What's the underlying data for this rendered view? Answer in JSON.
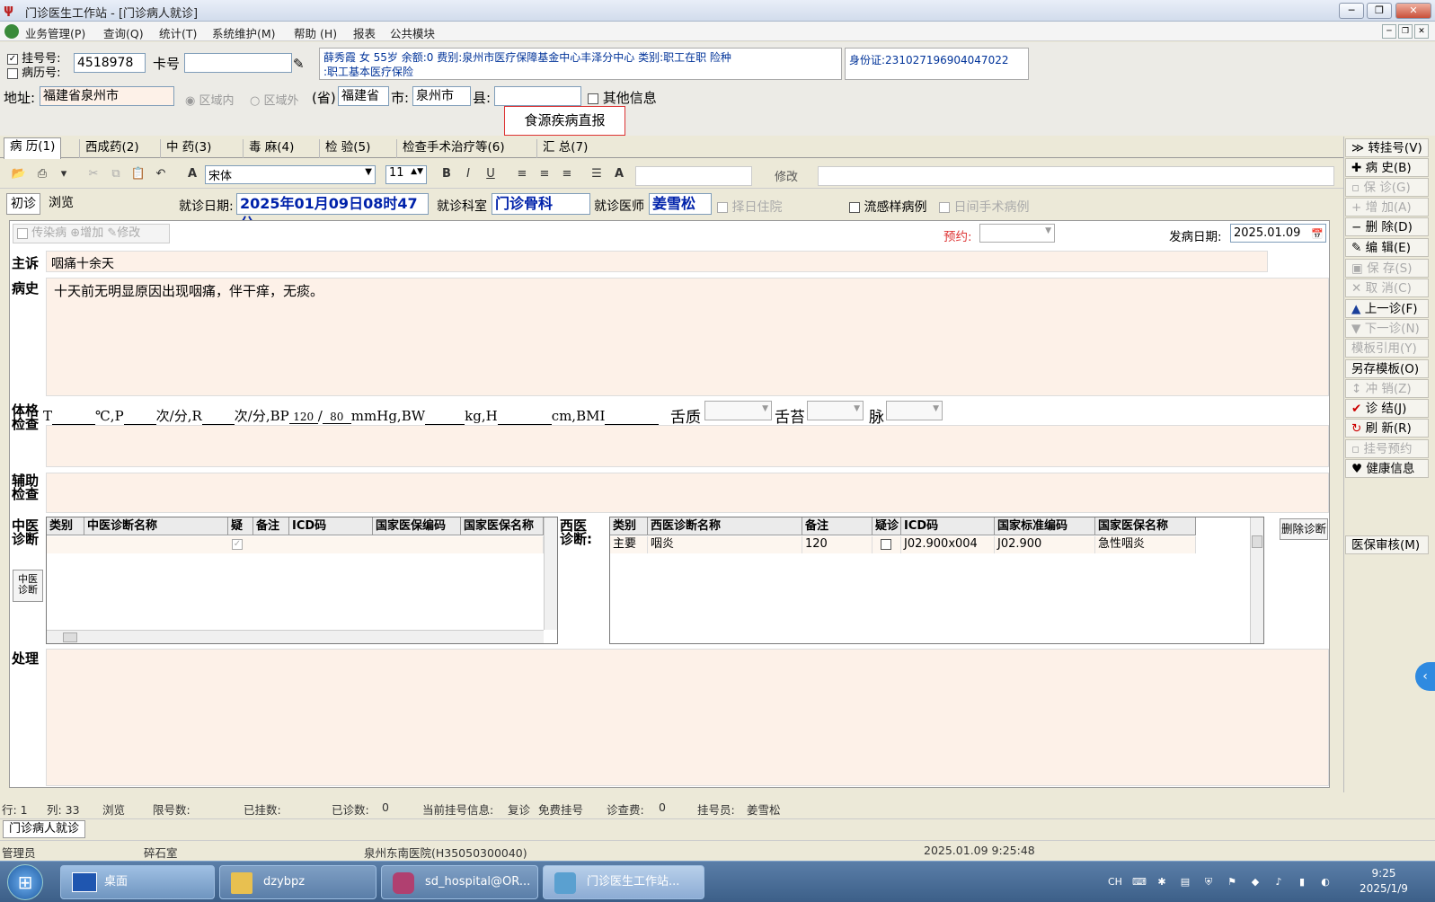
{
  "window": {
    "title": "门诊医生工作站 - [门诊病人就诊]",
    "minimize": "─",
    "restore": "❐",
    "close": "✕",
    "mdi_min": "─",
    "mdi_restore": "❐",
    "mdi_close": "✕"
  },
  "menu": [
    "业务管理(P)",
    "查询(Q)",
    "统计(T)",
    "系统维护(M)",
    "帮助 (H)",
    "报表",
    "公共模块"
  ],
  "info": {
    "reg_label": "挂号号:",
    "record_label": "病历号:",
    "reg_no": "4518978",
    "card_label": "卡号",
    "card_value": "",
    "patient_line1": "薛秀霞 女 55岁 余额:0 费别:泉州市医疗保障基金中心丰泽分中心 类别:职工在职 险种",
    "patient_line2": ":职工基本医疗保险",
    "id_card": "身份证:231027196904047022",
    "address_label": "地址:",
    "address": "福建省泉州市",
    "in_region": "区域内",
    "out_region": "区域外",
    "province_label": "(省)",
    "province": "福建省",
    "city_label": "市:",
    "city": "泉州市",
    "county_label": "县:",
    "county": "",
    "other_info": "其他信息",
    "notify_button": "食源疾病直报"
  },
  "tabs": [
    "病 历(1)",
    "西成药(2)",
    "中 药(3)",
    "毒 麻(4)",
    "检 验(5)",
    "检查手术治疗等(6)",
    "汇 总(7)"
  ],
  "toolbar": {
    "font": "宋体",
    "size": "11",
    "modify": "修改"
  },
  "visit": {
    "first_visit": "初诊",
    "browse": "浏览",
    "date_label": "就诊日期:",
    "date": "2025年01月09日08时47分",
    "dept_label": "就诊科室",
    "dept": "门诊骨科",
    "doctor_label": "就诊医师",
    "doctor": "姜雪松",
    "hospitalize": "择日住院",
    "flu": "流感样病例",
    "day_surgery": "日间手术病例",
    "infectious": "传染病",
    "add": "增加",
    "edit": "修改",
    "reserve_label": "预约:",
    "onset_label": "发病日期:",
    "onset_date": "2025.01.09"
  },
  "record": {
    "complaint_label": "主诉",
    "complaint": "咽痛十余天",
    "history_label": "病史",
    "history": "十天前无明显原因出现咽痛，伴干痒，无痰。",
    "exam_label": "体格检查",
    "vitals": {
      "t_label": "T",
      "t_unit": "℃,P",
      "p_unit": "次/分,R",
      "r_unit": "次/分,BP",
      "bp_sys": "120",
      "bp_sep": "/",
      "bp_dia": "80",
      "bp_unit": "mmHg,BW",
      "bw_unit": "kg,H",
      "h_unit": "cm,BMI",
      "tongue": "舌质",
      "coating": "舌苔",
      "pulse": "脉"
    },
    "aux_label": "辅助检查",
    "tcm_label": "中医诊断",
    "tcm_btn": "中医诊断",
    "wm_label": "西医诊断:",
    "treatment_label": "处理"
  },
  "tcm_grid": {
    "headers": [
      "类别",
      "中医诊断名称",
      "疑诊",
      "备注",
      "ICD码",
      "国家医保编码",
      "国家医保名称"
    ]
  },
  "wm_grid": {
    "headers": [
      "类别",
      "西医诊断名称",
      "备注",
      "疑诊",
      "ICD码",
      "国家标准编码",
      "国家医保名称"
    ],
    "rows": [
      [
        "主要",
        "咽炎",
        "120",
        "",
        "J02.900x004",
        "J02.900",
        "急性咽炎"
      ]
    ]
  },
  "delete_diag": "删除诊断",
  "side_buttons": [
    {
      "label": "转挂号(V)",
      "icon": "≫",
      "dim": false
    },
    {
      "label": "病 史(B)",
      "icon": "✚",
      "dim": false
    },
    {
      "label": "保 诊(G)",
      "icon": "▫",
      "dim": true
    },
    {
      "label": "增 加(A)",
      "icon": "+",
      "dim": true
    },
    {
      "label": "删 除(D)",
      "icon": "−",
      "dim": false
    },
    {
      "label": "编 辑(E)",
      "icon": "✎",
      "dim": false
    },
    {
      "label": "保 存(S)",
      "icon": "▣",
      "dim": true
    },
    {
      "label": "取 消(C)",
      "icon": "✕",
      "dim": true
    },
    {
      "label": "上一诊(F)",
      "icon": "▲",
      "dim": false
    },
    {
      "label": "下一诊(N)",
      "icon": "▼",
      "dim": true
    },
    {
      "label": "模板引用(Y)",
      "icon": "",
      "dim": true
    },
    {
      "label": "另存模板(O)",
      "icon": "",
      "dim": false
    },
    {
      "label": "冲 销(Z)",
      "icon": "↕",
      "dim": true
    },
    {
      "label": "诊 结(J)",
      "icon": "✔",
      "dim": false
    },
    {
      "label": "刷 新(R)",
      "icon": "↻",
      "dim": false
    },
    {
      "label": "挂号预约",
      "icon": "▫",
      "dim": true
    },
    {
      "label": "健康信息",
      "icon": "♥",
      "dim": false
    }
  ],
  "insurance_review": "医保审核(M)",
  "status": {
    "row": "行: 1",
    "col": "列: 33",
    "browse": "浏览",
    "limit": "限号数:",
    "registered": "已挂数:",
    "seen": "已诊数:",
    "seen_val": "0",
    "current": "当前挂号信息:",
    "revisit": "复诊",
    "free": "免费挂号",
    "fee": "诊查费:",
    "fee_val": "0",
    "registrar": "挂号员:",
    "registrar_val": "姜雪松"
  },
  "doc_tab": "门诊病人就诊",
  "bottom": {
    "role": "管理员",
    "room": "碎石室",
    "hospital": "泉州东南医院(H35050300040)",
    "datetime": "2025.01.09 9:25:48"
  },
  "taskbar": {
    "start": "⊞",
    "tasks": [
      "桌面",
      "dzybpz",
      "sd_hospital@OR...",
      "门诊医生工作站..."
    ],
    "lang": "CH",
    "time": "9:25",
    "date": "2025/1/9"
  }
}
